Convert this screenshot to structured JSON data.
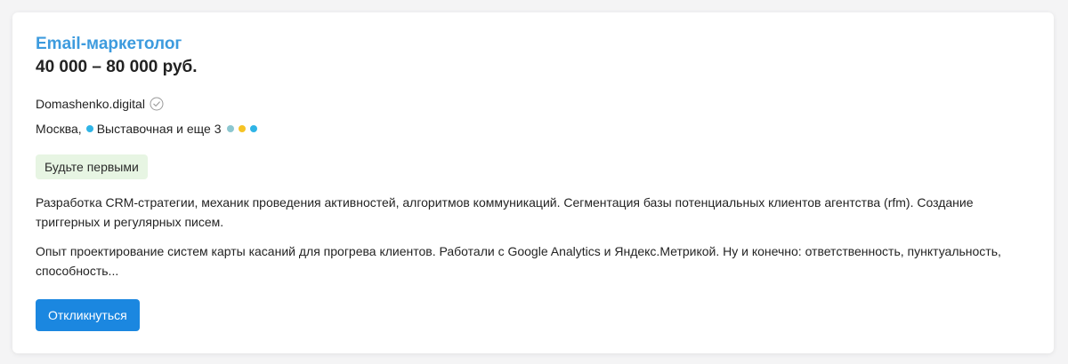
{
  "vacancy": {
    "title": "Email-маркетолог",
    "salary": "40 000 – 80 000 руб.",
    "company": "Domashenko.digital",
    "verified_icon": "verified-check-icon",
    "location": {
      "city": "Москва,",
      "metro_station": "Выставочная",
      "more_text": "и еще 3",
      "metro_dot_color": "#2fb4e6",
      "more_dot_colors": [
        "#8cc7d0",
        "#f6c325",
        "#2fb4e6"
      ]
    },
    "badge": "Будьте первыми",
    "badge_color": "#e7f5e3",
    "description": [
      "Разработка CRM-стратегии, механик проведения активностей, алгоритмов коммуникаций. Сегментация базы потенциальных клиентов агентства (rfm). Создание триггерных и регулярных писем.",
      "Опыт проектирование систем карты касаний для прогрева клиентов. Работали с Google Analytics и Яндекс.Метрикой. Ну и конечно: ответственность, пунктуальность, способность..."
    ],
    "apply_label": "Откликнуться",
    "colors": {
      "title": "#3d9bde",
      "button": "#1b87e0"
    }
  }
}
